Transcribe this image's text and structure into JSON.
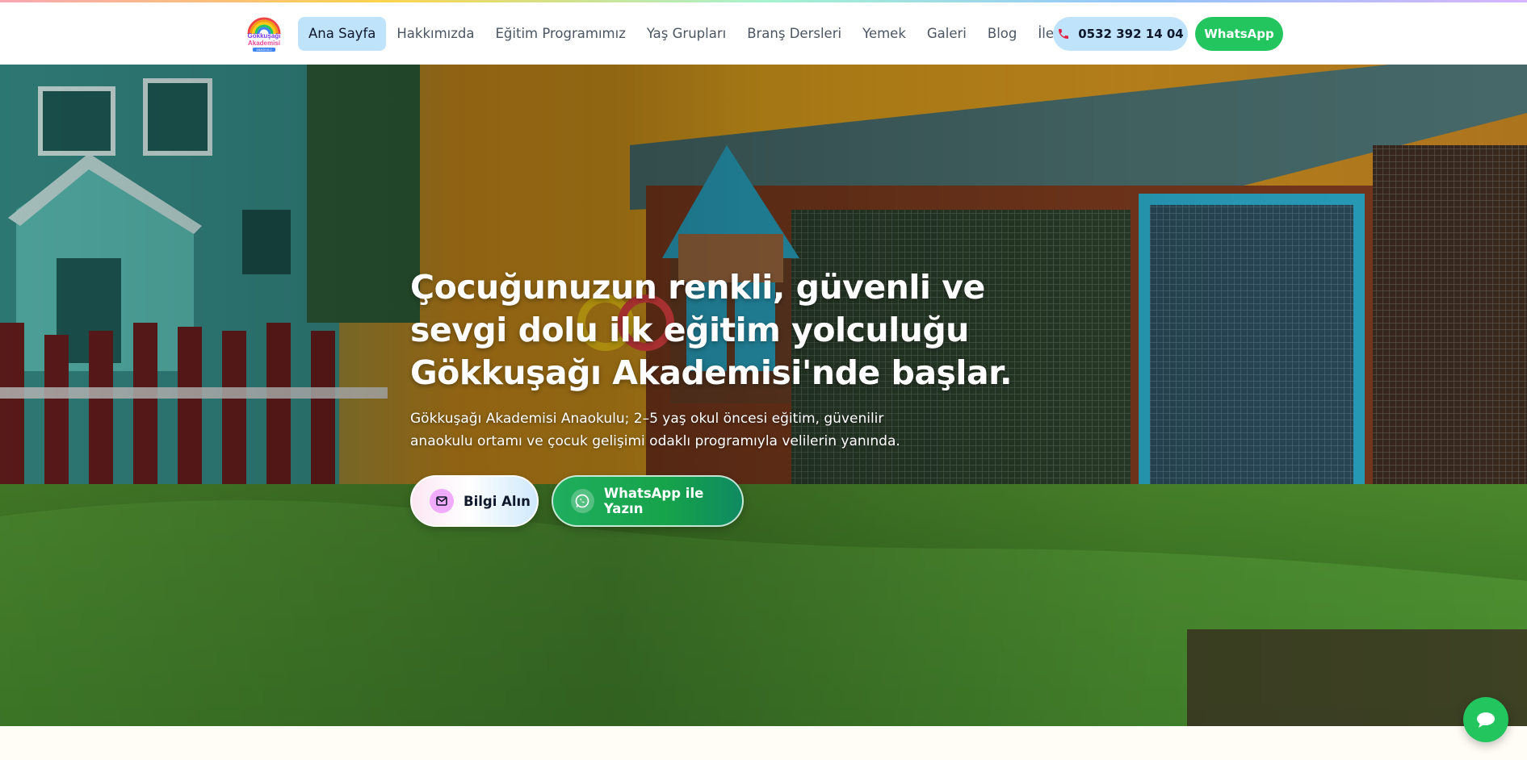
{
  "brand": {
    "logo_lines": [
      "Gökkuşağı",
      "Akademisi",
      "ANAOKULU"
    ],
    "colors": {
      "primary_green": "#22c55e",
      "light_blue": "#bfe3fb",
      "accent_pink": "#f0abfc"
    }
  },
  "nav": {
    "items": [
      {
        "label": "Ana Sayfa",
        "active": true
      },
      {
        "label": "Hakkımızda"
      },
      {
        "label": "Eğitim Programımız"
      },
      {
        "label": "Yaş Grupları"
      },
      {
        "label": "Branş Dersleri"
      },
      {
        "label": "Yemek"
      },
      {
        "label": "Galeri"
      },
      {
        "label": "Blog"
      },
      {
        "label": "İletişim"
      }
    ],
    "phone": {
      "label": "0532 392 14 04",
      "icon": "phone-icon"
    },
    "whatsapp": {
      "label": "WhatsApp"
    }
  },
  "hero": {
    "title": "Çocuğunuzun renkli, güvenli ve sevgi dolu ilk eğitim yolculuğu Gökkuşağı Akademisi'nde başlar.",
    "subtitle": "Gökkuşağı Akademisi Anaokulu; 2–5 yaş okul öncesi eğitim, güvenilir anaokulu ortamı ve çocuk gelişimi odaklı programıyla velilerin yanında.",
    "buttons": {
      "info": {
        "label": "Bilgi Alın",
        "icon": "mail-icon"
      },
      "whatsapp": {
        "label": "WhatsApp ile Yazın",
        "icon": "whatsapp-icon"
      }
    }
  },
  "floating_chat": {
    "icon": "chat-bubble-icon"
  }
}
